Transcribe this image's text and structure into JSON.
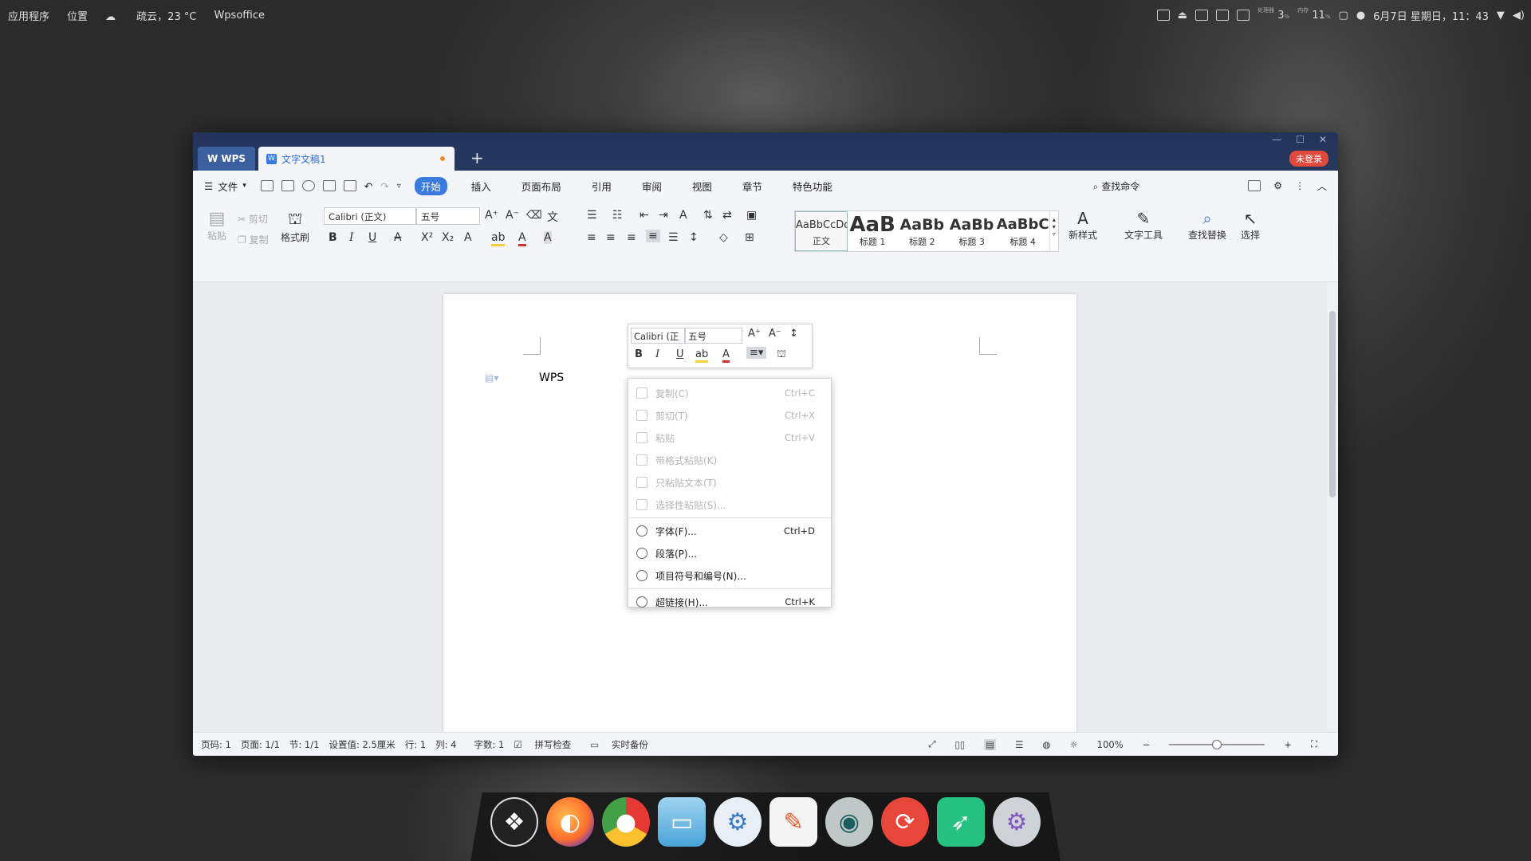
{
  "top_panel": {
    "apps": "应用程序",
    "places": "位置",
    "weather": "疏云，23 °C",
    "active_app": "Wpsoffice",
    "cpu_label": "处理器",
    "cpu_value": "3",
    "mem_label": "内存",
    "mem_value": "11",
    "percent": "%",
    "datetime": "6月7日 星期日，11：43"
  },
  "window": {
    "wps_tab": "WPS",
    "doc_tab": "文字文稿1",
    "add_tab": "+",
    "login": "未登录"
  },
  "menubar": {
    "file": "文件",
    "tabs": [
      "开始",
      "插入",
      "页面布局",
      "引用",
      "审阅",
      "视图",
      "章节",
      "特色功能"
    ],
    "active_tab": "开始",
    "search": "查找命令"
  },
  "ribbon": {
    "paste": "粘贴",
    "cut": "剪切",
    "copy": "复制",
    "format_painter": "格式刷",
    "font": "Calibri (正文)",
    "size": "五号",
    "styles": [
      {
        "sample": "AaBbCcDd",
        "label": "正文"
      },
      {
        "sample": "AaB",
        "label": "标题 1"
      },
      {
        "sample": "AaBb",
        "label": "标题 2"
      },
      {
        "sample": "AaBb",
        "label": "标题 3"
      },
      {
        "sample": "AaBbC",
        "label": "标题 4"
      }
    ],
    "new_style": "新样式",
    "text_tools": "文字工具",
    "find_replace": "查找替换",
    "select": "选择"
  },
  "document": {
    "text": "WPS"
  },
  "float_toolbar": {
    "font": "Calibri (正",
    "size": "五号"
  },
  "context_menu": {
    "items": [
      {
        "label": "复制(C)",
        "shortcut": "Ctrl+C",
        "disabled": true
      },
      {
        "label": "剪切(T)",
        "shortcut": "Ctrl+X",
        "disabled": true
      },
      {
        "label": "粘贴",
        "shortcut": "Ctrl+V",
        "disabled": true
      },
      {
        "label": "带格式粘贴(K)",
        "shortcut": "",
        "disabled": true
      },
      {
        "label": "只粘贴文本(T)",
        "shortcut": "",
        "disabled": true
      },
      {
        "label": "选择性粘贴(S)...",
        "shortcut": "",
        "disabled": true
      },
      {
        "label": "字体(F)...",
        "shortcut": "Ctrl+D",
        "disabled": false
      },
      {
        "label": "段落(P)...",
        "shortcut": "",
        "disabled": false
      },
      {
        "label": "项目符号和编号(N)...",
        "shortcut": "",
        "disabled": false
      },
      {
        "label": "超链接(H)...",
        "shortcut": "Ctrl+K",
        "disabled": false
      }
    ]
  },
  "statusbar": {
    "page_no": "页码: 1",
    "pages": "页面: 1/1",
    "section": "节: 1/1",
    "setting": "设置值: 2.5厘米",
    "row": "行: 1",
    "col": "列: 4",
    "words": "字数: 1",
    "spell": "拼写检查",
    "backup": "实时备份",
    "zoom": "100%",
    "zoom_level": 0.5
  },
  "dock": {
    "apps": [
      "deepin-launcher-icon",
      "firefox-icon",
      "chrome-icon",
      "file-manager-icon",
      "settings-icon",
      "text-editor-icon",
      "screen-recorder-icon",
      "update-icon",
      "launcher-rocket-icon",
      "disk-utility-icon"
    ]
  }
}
